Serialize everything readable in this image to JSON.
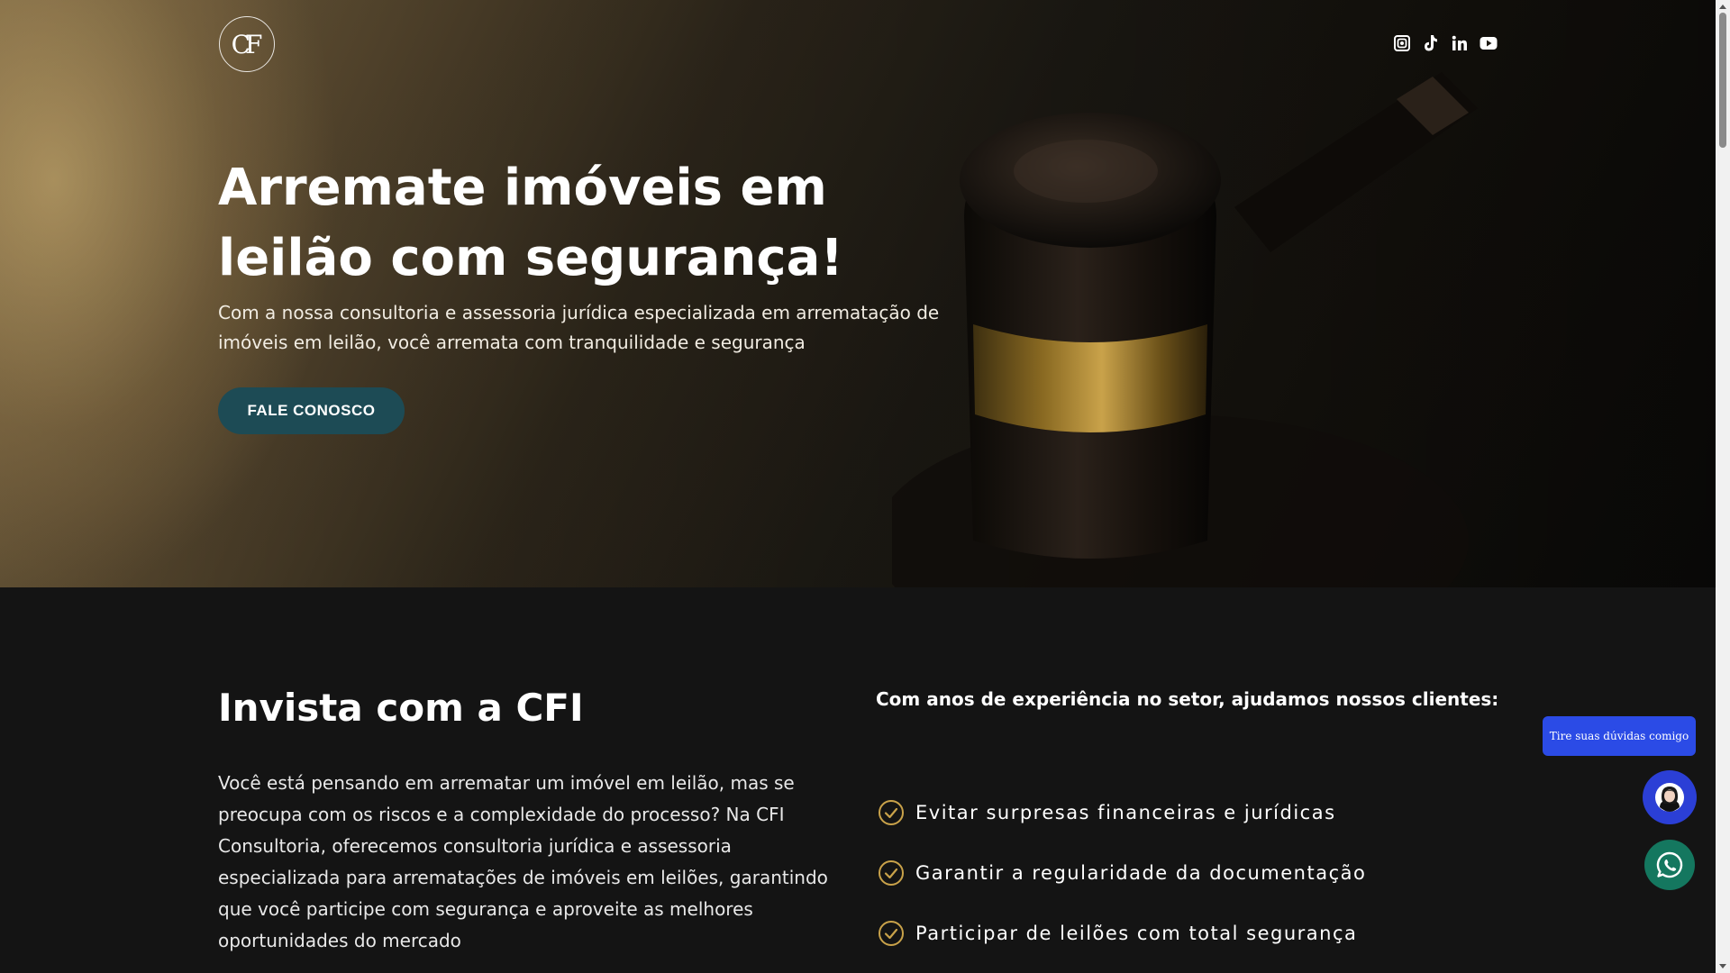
{
  "header": {
    "logo_text": "CF",
    "social_icons": [
      "instagram-icon",
      "tiktok-icon",
      "linkedin-icon",
      "youtube-icon"
    ]
  },
  "hero": {
    "title_line1": "Arremate imóveis em",
    "title_line2": "leilão com segurança!",
    "subtitle": "Com a nossa consultoria e assessoria jurídica especializada em arrematação de imóveis em leilão, você arremata com tranquilidade e segurança",
    "cta_label": "FALE CONOSCO"
  },
  "about": {
    "title": "Invista com a CFI",
    "text": "Você está pensando em arrematar um imóvel em leilão, mas se preocupa com os riscos e a complexidade do processo? Na CFI Consultoria, oferecemos consultoria jurídica e assessoria especializada para arrematações de imóveis em leilões, garantindo que você participe com segurança e aproveite as melhores oportunidades do mercado"
  },
  "benefits": {
    "heading": "Com anos de experiência no setor, ajudamos nossos clientes:",
    "items": [
      {
        "label": "Evitar surpresas financeiras e jurídicas"
      },
      {
        "label": "Garantir a regularidade da documentação"
      },
      {
        "label": "Participar de leilões com total segurança"
      }
    ]
  },
  "widgets": {
    "chat_tooltip": "Tire suas dúvidas comigo"
  },
  "colors": {
    "cta_bg": "#1d4b55",
    "accent_gold": "#c9a24a",
    "section_bg": "#141414",
    "chat_blue": "#2b4be6",
    "whatsapp_green": "#14775f"
  }
}
